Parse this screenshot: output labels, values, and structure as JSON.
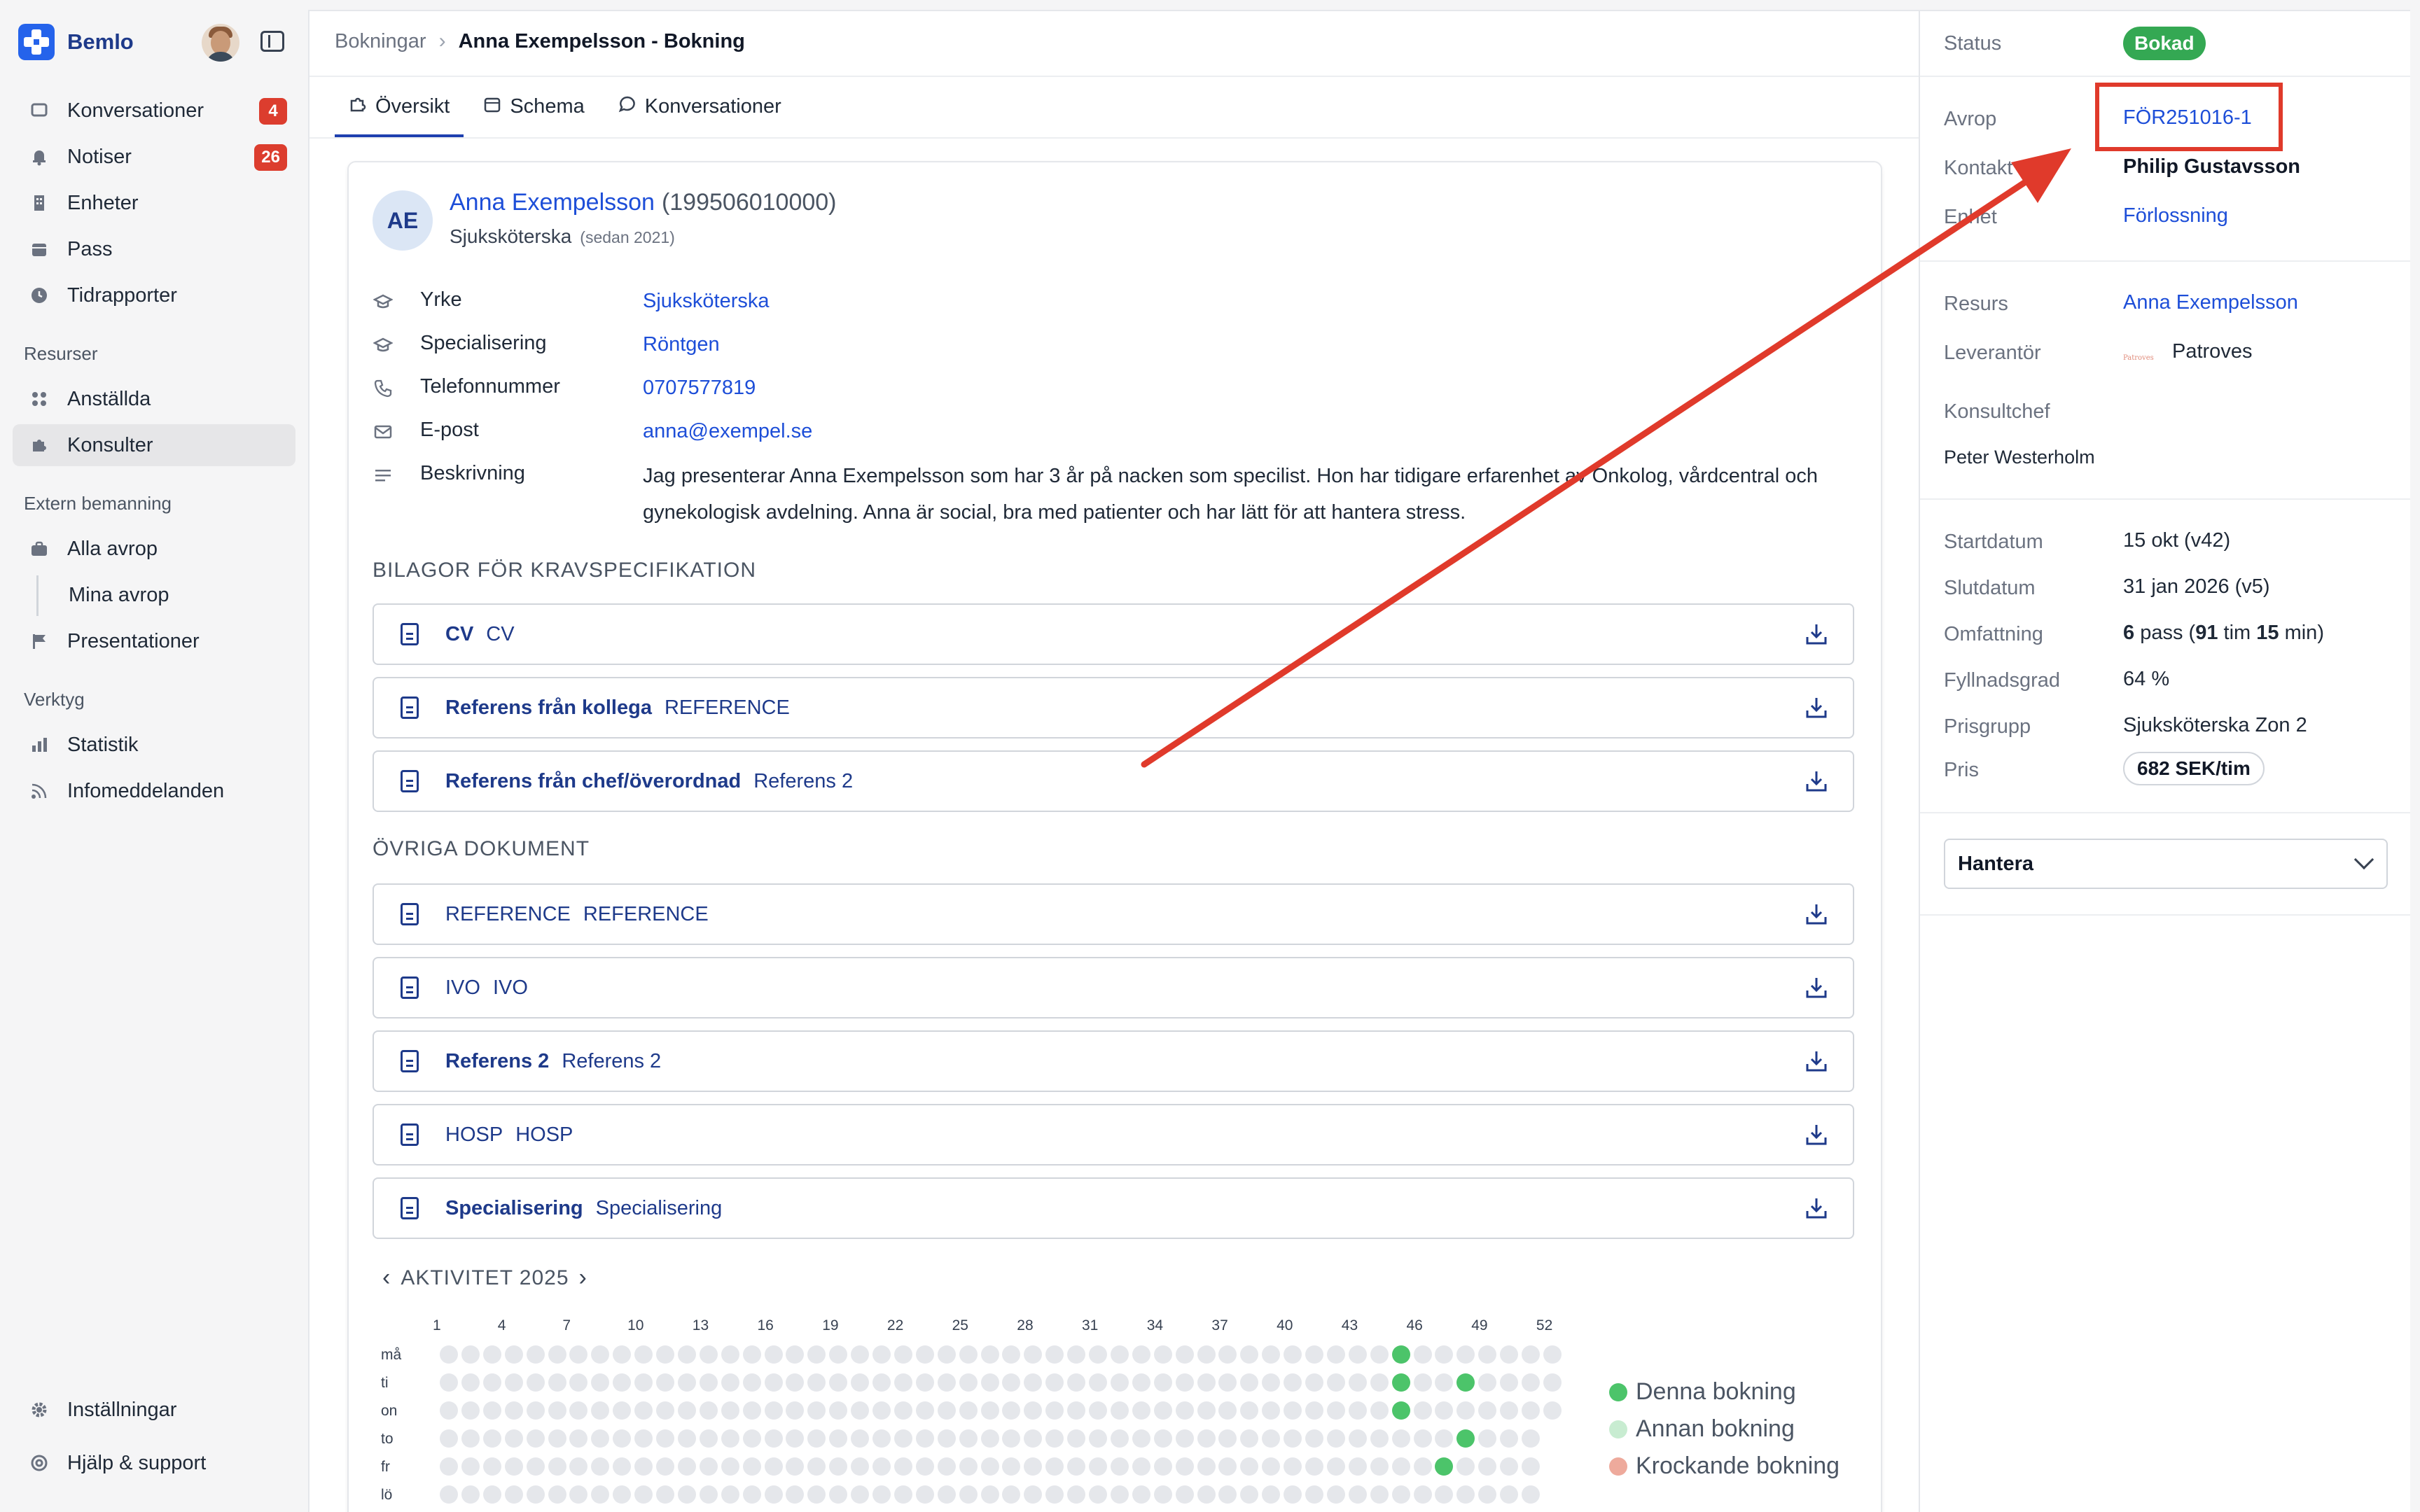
{
  "app": {
    "name": "Bemlo"
  },
  "sidebar": {
    "items": [
      {
        "label": "Konversationer",
        "badge": "4"
      },
      {
        "label": "Notiser",
        "badge": "26"
      },
      {
        "label": "Enheter"
      },
      {
        "label": "Pass"
      },
      {
        "label": "Tidrapporter"
      }
    ],
    "sections": {
      "resurser": "Resurser",
      "extern": "Extern bemanning",
      "verktyg": "Verktyg"
    },
    "resurser_items": [
      {
        "label": "Anställda"
      },
      {
        "label": "Konsulter"
      }
    ],
    "extern_items": [
      {
        "label": "Alla avrop"
      },
      {
        "label": "Mina avrop"
      },
      {
        "label": "Presentationer"
      }
    ],
    "verktyg_items": [
      {
        "label": "Statistik"
      },
      {
        "label": "Infomeddelanden"
      }
    ],
    "bottom_items": [
      {
        "label": "Inställningar"
      },
      {
        "label": "Hjälp & support"
      }
    ]
  },
  "breadcrumb": {
    "parent": "Bokningar",
    "current": "Anna Exempelsson - Bokning"
  },
  "tabs": [
    {
      "label": "Översikt"
    },
    {
      "label": "Schema"
    },
    {
      "label": "Konversationer"
    }
  ],
  "profile": {
    "initials": "AE",
    "name": "Anna Exempelsson",
    "personal_number": "(199506010000)",
    "role": "Sjuksköterska",
    "since": "(sedan 2021)",
    "fields": [
      {
        "label": "Yrke",
        "value": "Sjuksköterska"
      },
      {
        "label": "Specialisering",
        "value": "Röntgen"
      },
      {
        "label": "Telefonnummer",
        "value": "0707577819"
      },
      {
        "label": "E-post",
        "value": "anna@exempel.se"
      },
      {
        "label": "Beskrivning",
        "value": "Jag presenterar Anna Exempelsson som har 3 år på nacken som specilist. Hon har tidigare erfarenhet av Onkolog, vårdcentral och gynekologisk avdelning. Anna är social, bra med patienter och har lätt för att hantera stress."
      }
    ]
  },
  "attachments": {
    "title": "BILAGOR FÖR KRAVSPECIFIKATION",
    "items": [
      {
        "name": "CV",
        "type": "CV"
      },
      {
        "name": "Referens från kollega",
        "type": "REFERENCE"
      },
      {
        "name": "Referens från chef/överordnad",
        "type": "Referens 2"
      }
    ]
  },
  "other_documents": {
    "title": "ÖVRIGA DOKUMENT",
    "items": [
      {
        "name": "REFERENCE",
        "type": "REFERENCE"
      },
      {
        "name": "IVO",
        "type": "IVO"
      },
      {
        "name": "Referens 2",
        "type": "Referens 2"
      },
      {
        "name": "HOSP",
        "type": "HOSP"
      },
      {
        "name": "Specialisering",
        "type": "Specialisering"
      }
    ]
  },
  "activity": {
    "title": "AKTIVITET 2025",
    "week_labels": [
      "1",
      "4",
      "7",
      "10",
      "13",
      "16",
      "19",
      "22",
      "25",
      "28",
      "31",
      "34",
      "37",
      "40",
      "43",
      "46",
      "49",
      "52"
    ],
    "day_labels": [
      "må",
      "ti",
      "on",
      "to",
      "fr",
      "lö"
    ],
    "booked_cells": [
      {
        "day": 0,
        "week": 44
      },
      {
        "day": 1,
        "week": 44
      },
      {
        "day": 1,
        "week": 47
      },
      {
        "day": 2,
        "week": 44
      },
      {
        "day": 3,
        "week": 47
      },
      {
        "day": 4,
        "week": 46
      }
    ],
    "legend": [
      {
        "label": "Denna bokning",
        "color": "#4cc46a"
      },
      {
        "label": "Annan bokning",
        "color": "#c8ecd1"
      },
      {
        "label": "Krockande bokning",
        "color": "#eeaa9c"
      }
    ]
  },
  "details": {
    "status": {
      "label": "Status",
      "value": "Bokad"
    },
    "avrop": {
      "label": "Avrop",
      "value": "FÖR251016-1"
    },
    "kontakt": {
      "label": "Kontakt",
      "value": "Philip Gustavsson"
    },
    "enhet": {
      "label": "Enhet",
      "value": "Förlossning"
    },
    "resurs": {
      "label": "Resurs",
      "value": "Anna Exempelsson"
    },
    "leverantor": {
      "label": "Leverantör",
      "value": "Patroves",
      "logo_text": "Patroves"
    },
    "konsultchef": {
      "label": "Konsultchef",
      "value": "Peter Westerholm"
    },
    "startdatum": {
      "label": "Startdatum",
      "value": "15 okt (v42)"
    },
    "slutdatum": {
      "label": "Slutdatum",
      "value": "31 jan 2026 (v5)"
    },
    "omfattning": {
      "label": "Omfattning",
      "pass": "6",
      "pass_unit": "pass",
      "hours": "91",
      "hours_unit": "tim",
      "minutes": "15",
      "minutes_unit": "min"
    },
    "fyllnadsgrad": {
      "label": "Fyllnadsgrad",
      "value": "64 %"
    },
    "prisgrupp": {
      "label": "Prisgrupp",
      "value": "Sjuksköterska Zon 2"
    },
    "pris": {
      "label": "Pris",
      "value": "682 SEK/tim"
    },
    "hantera": "Hantera"
  },
  "colors": {
    "brand": "#2563eb",
    "link": "#1d4ed8",
    "badge": "#dc3d2e",
    "status": "#34a853",
    "annotation": "#e03a2b"
  }
}
